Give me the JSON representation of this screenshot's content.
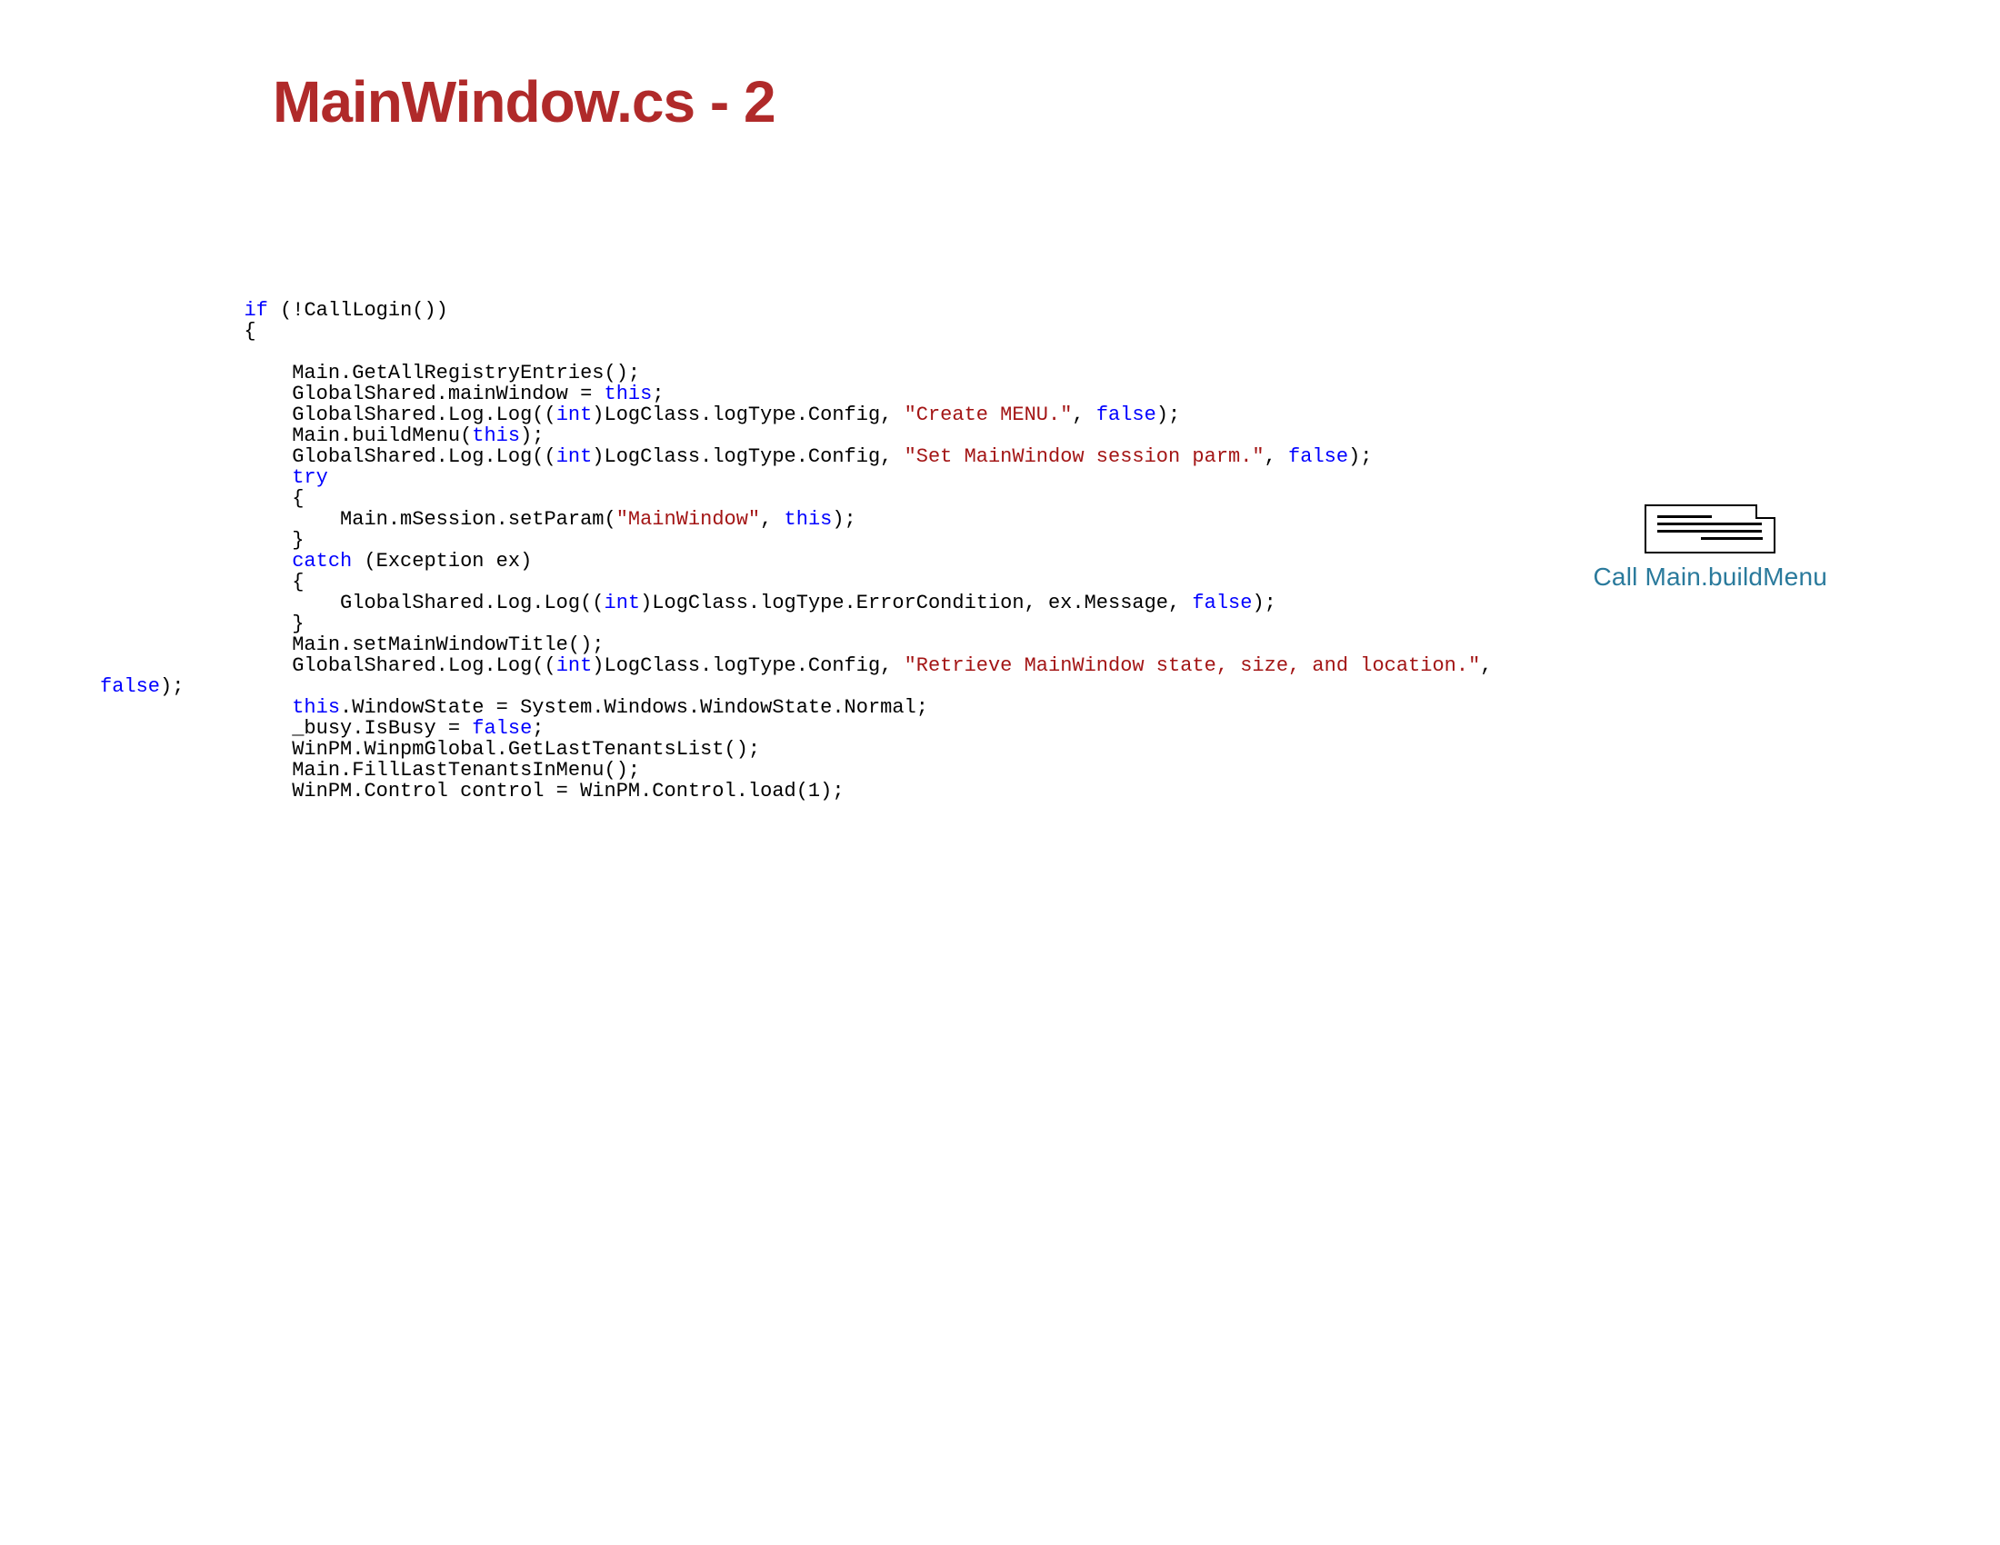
{
  "title": "MainWindow.cs - 2",
  "annotation": {
    "label": "Call Main.buildMenu"
  },
  "code": {
    "l01_kw": "if",
    "l01_rest": " (!CallLogin())",
    "l02": "            {",
    "l03": "",
    "l04": "                Main.GetAllRegistryEntries();",
    "l05_a": "                GlobalShared.mainWindow = ",
    "l05_kw": "this",
    "l05_b": ";",
    "l06_a": "                GlobalShared.Log.Log((",
    "l06_kw": "int",
    "l06_b": ")LogClass.logType.Config, ",
    "l06_str": "\"Create MENU.\"",
    "l06_c": ", ",
    "l06_kw2": "false",
    "l06_d": ");",
    "l07_a": "                Main.buildMenu(",
    "l07_kw": "this",
    "l07_b": ");",
    "l08_a": "                GlobalShared.Log.Log((",
    "l08_kw": "int",
    "l08_b": ")LogClass.logType.Config, ",
    "l08_str": "\"Set MainWindow session parm.\"",
    "l08_c": ", ",
    "l08_kw2": "false",
    "l08_d": ");",
    "l09_a": "                ",
    "l09_kw": "try",
    "l10": "                {",
    "l11_a": "                    Main.mSession.setParam(",
    "l11_str": "\"MainWindow\"",
    "l11_b": ", ",
    "l11_kw": "this",
    "l11_c": ");",
    "l12": "                }",
    "l13_a": "                ",
    "l13_kw": "catch",
    "l13_b": " (Exception ex)",
    "l14": "                {",
    "l15_a": "                    GlobalShared.Log.Log((",
    "l15_kw": "int",
    "l15_b": ")LogClass.logType.ErrorCondition, ex.Message, ",
    "l15_kw2": "false",
    "l15_c": ");",
    "l16": "                }",
    "l17": "                Main.setMainWindowTitle();",
    "l18_a": "                GlobalShared.Log.Log((",
    "l18_kw": "int",
    "l18_b": ")LogClass.logType.Config, ",
    "l18_str": "\"Retrieve MainWindow state, size, and location.\"",
    "l18_c": ", ",
    "l19_kw": "false",
    "l19_a": ");",
    "l20_a": "                ",
    "l20_kw": "this",
    "l20_b": ".WindowState = System.Windows.WindowState.Normal;",
    "l21_a": "                _busy.IsBusy = ",
    "l21_kw": "false",
    "l21_b": ";",
    "l22": "                WinPM.WinpmGlobal.GetLastTenantsList();",
    "l23": "                Main.FillLastTenantsInMenu();",
    "l24": "                WinPM.Control control = WinPM.Control.load(1);"
  }
}
